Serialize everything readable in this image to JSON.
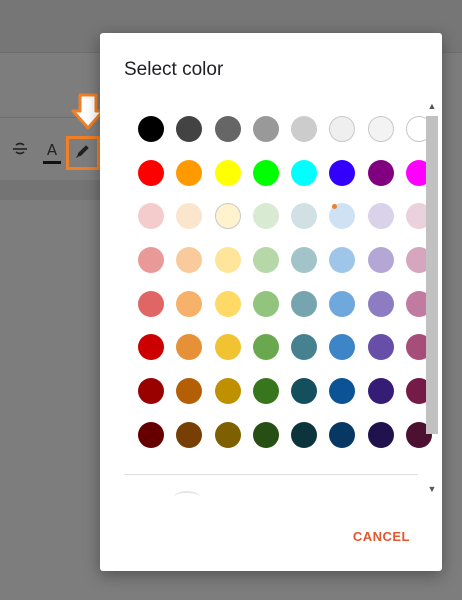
{
  "dialog": {
    "title": "Select color",
    "cancel_label": "CANCEL"
  },
  "toolbar": {
    "textcolor_letter": "A"
  },
  "selected_swatch": "light blue 3",
  "palette": [
    [
      "#000000",
      "#434343",
      "#666666",
      "#999999",
      "#cccccc",
      "#efefef",
      "#f3f3f3",
      "#ffffff"
    ],
    [
      "#ff0000",
      "#ff9900",
      "#ffff00",
      "#00ff00",
      "#00ffff",
      "#3300ff",
      "#800080",
      "#ff00ff"
    ],
    [
      "#f4cccc",
      "#fce5cd",
      "#fff2cc",
      "#d9ead3",
      "#d0e0e3",
      "#cfe2f3",
      "#d9d2e9",
      "#ead1dc"
    ],
    [
      "#ea9999",
      "#f9cb9c",
      "#ffe599",
      "#b6d7a8",
      "#a2c4c9",
      "#9fc5e8",
      "#b4a7d6",
      "#d5a6bd"
    ],
    [
      "#e06666",
      "#f6b26b",
      "#ffd966",
      "#93c47d",
      "#76a5af",
      "#6fa8dc",
      "#8e7cc3",
      "#c27ba0"
    ],
    [
      "#cc0000",
      "#e69138",
      "#f1c232",
      "#6aa84f",
      "#45818e",
      "#3d85c6",
      "#674ea7",
      "#a64d79"
    ],
    [
      "#990000",
      "#b45f06",
      "#bf9000",
      "#38761d",
      "#134f5c",
      "#0b5394",
      "#351c75",
      "#741b47"
    ],
    [
      "#660000",
      "#783f04",
      "#7f6000",
      "#274e13",
      "#0c343d",
      "#073763",
      "#20124d",
      "#4c1130"
    ]
  ],
  "colors": {
    "accent": "#e4572e",
    "annotation": "#f07f26"
  }
}
